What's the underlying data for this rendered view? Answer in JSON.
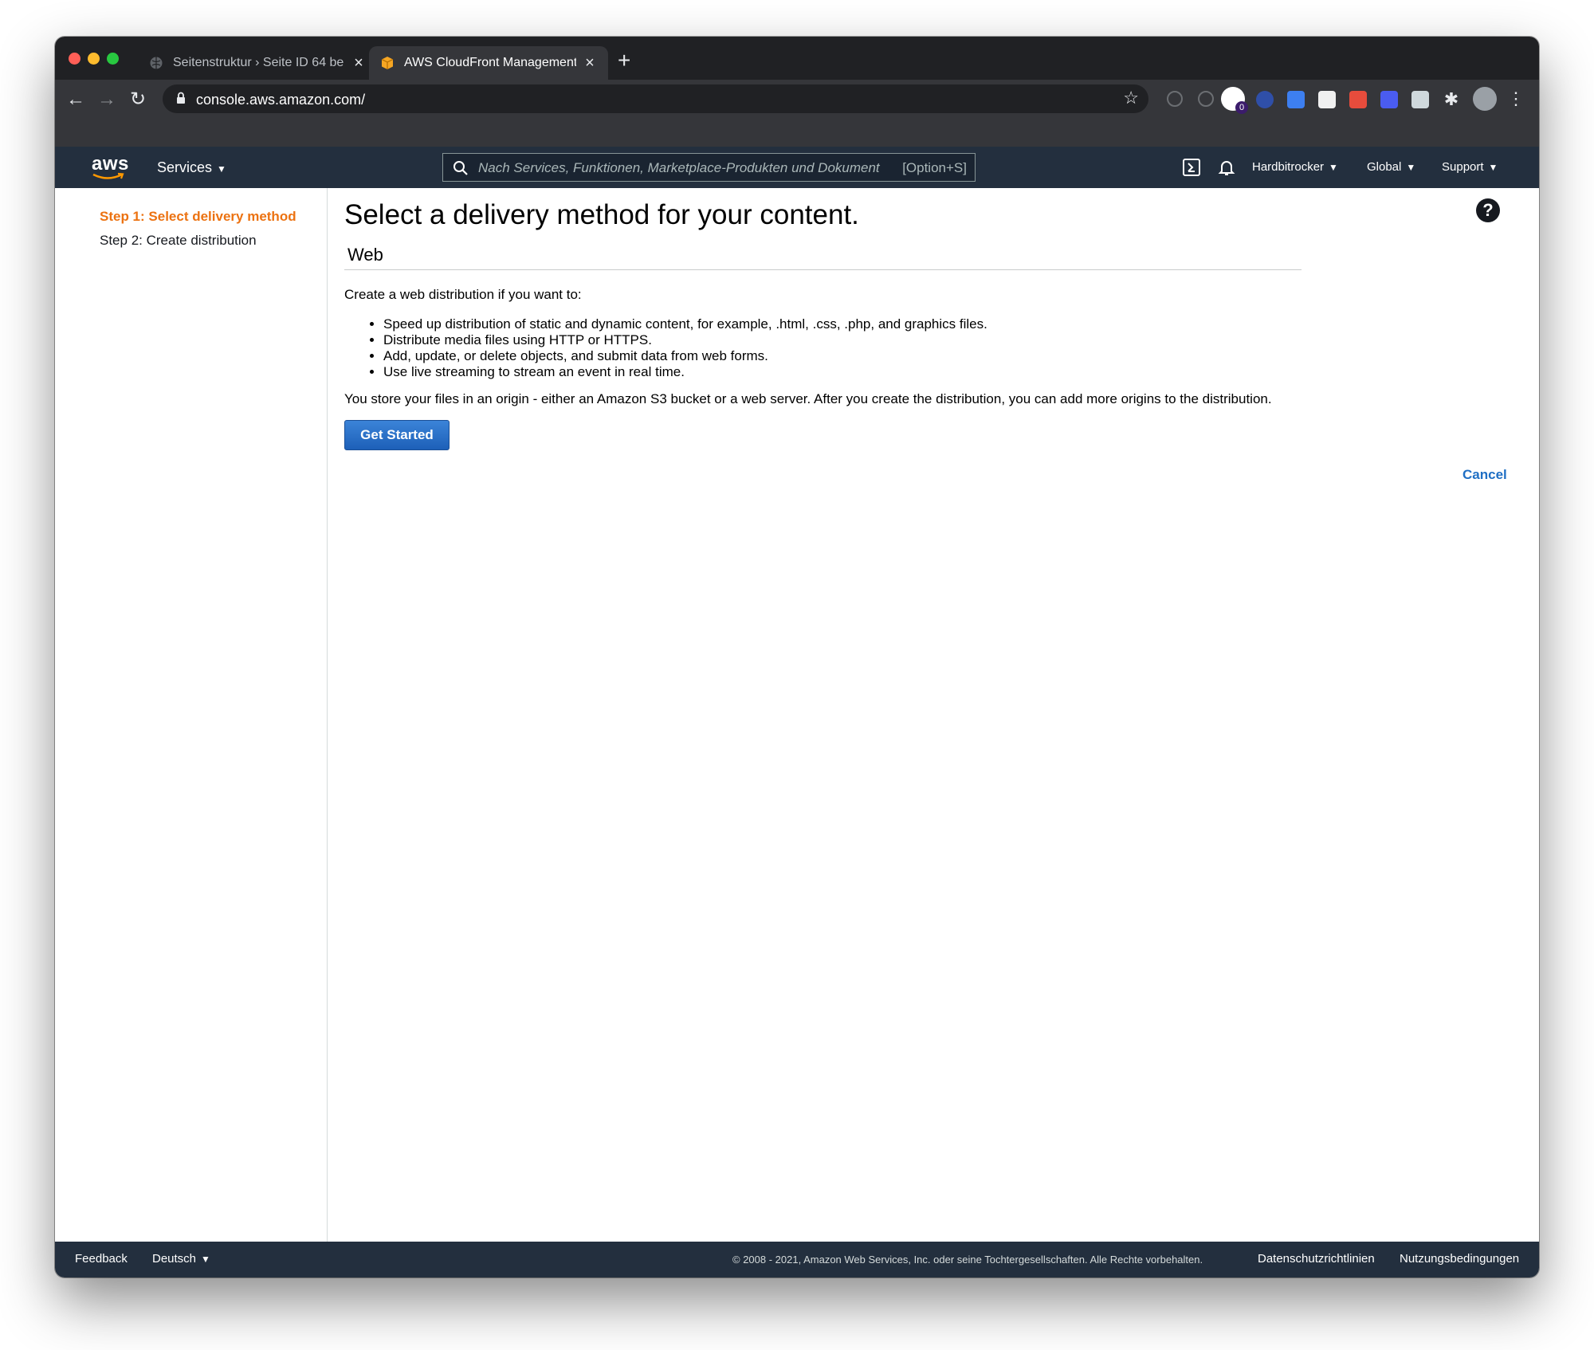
{
  "browser": {
    "tabs": [
      {
        "title": "Seitenstruktur › Seite ID 64 be",
        "active": false
      },
      {
        "title": "AWS CloudFront Management",
        "active": true
      }
    ],
    "url": "console.aws.amazon.com/",
    "extensions_badge": "0"
  },
  "aws_nav": {
    "logo_text": "aws",
    "services_label": "Services",
    "search_placeholder": "Nach Services, Funktionen, Marketplace-Produkten und Dokument",
    "search_shortcut": "[Option+S]",
    "account_label": "Hardbitrocker",
    "region_label": "Global",
    "support_label": "Support"
  },
  "sidebar": {
    "steps": [
      {
        "label": "Step 1: Select delivery method",
        "active": true
      },
      {
        "label": "Step 2: Create distribution",
        "active": false
      }
    ]
  },
  "main": {
    "heading": "Select a delivery method for your content.",
    "section_title": "Web",
    "intro": "Create a web distribution if you want to:",
    "bullets": [
      "Speed up distribution of static and dynamic content, for example, .html, .css, .php, and graphics files.",
      "Distribute media files using HTTP or HTTPS.",
      "Add, update, or delete objects, and submit data from web forms.",
      "Use live streaming to stream an event in real time."
    ],
    "store_text": "You store your files in an origin - either an Amazon S3 bucket or a web server. After you create the distribution, you can add more origins to the distribution.",
    "get_started_label": "Get Started",
    "cancel_label": "Cancel"
  },
  "footer": {
    "feedback_label": "Feedback",
    "language_label": "Deutsch",
    "copyright": "© 2008 - 2021, Amazon Web Services, Inc. oder seine Tochtergesellschaften. Alle Rechte vorbehalten.",
    "privacy_label": "Datenschutzrichtlinien",
    "terms_label": "Nutzungsbedingungen"
  },
  "colors": {
    "aws_nav_bg": "#232f3e",
    "step_active": "#ec7211",
    "button_primary": "#1d60b8",
    "link": "#1f6fc4"
  }
}
